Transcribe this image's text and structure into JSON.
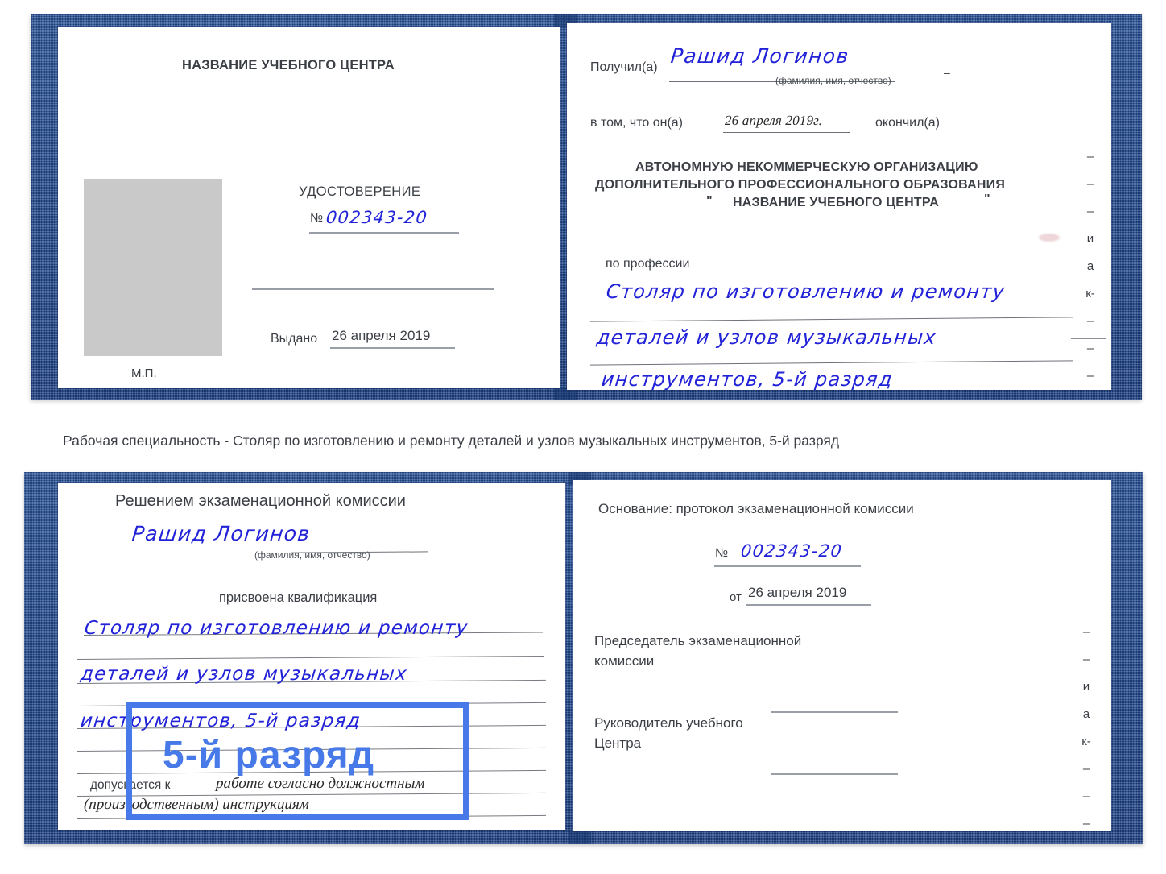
{
  "document_top": {
    "left_page": {
      "center_name_title": "НАЗВАНИЕ УЧЕБНОГО ЦЕНТРА",
      "doc_type": "УДОСТОВЕРЕНИЕ",
      "number_label": "№",
      "number_value": "002343-20",
      "issued_label": "Выдано",
      "issued_value": "26 апреля 2019",
      "stamp_label": "М.П."
    },
    "right_page": {
      "received_label": "Получил(а)",
      "received_value": "Рашид Логинов",
      "received_hint": "(фамилия, имя, отчество)",
      "in_that_label": "в том, что он(а)",
      "completion_date": "26 апреля 2019г.",
      "finished_label": "окончил(а)",
      "org_line1": "АВТОНОМНУЮ НЕКОММЕРЧЕСКУЮ ОРГАНИЗАЦИЮ",
      "org_line2": "ДОПОЛНИТЕЛЬНОГО ПРОФЕССИОНАЛЬНОГО ОБРАЗОВАНИЯ",
      "org_quote_open": "\"",
      "org_name": "НАЗВАНИЕ УЧЕБНОГО ЦЕНТРА",
      "org_quote_close": "\"",
      "profession_label": "по профессии",
      "profession_line1": "Столяр по изготовлению и ремонту",
      "profession_line2": "деталей и узлов музыкальных",
      "profession_line3": "инструментов, 5-й разряд",
      "edge_glyphs": [
        "–",
        "–",
        "–",
        "и",
        "а",
        "к-",
        "–",
        "–",
        "–"
      ]
    }
  },
  "caption": {
    "text": "Рабочая специальность - Столяр по изготовлению и ремонту деталей и узлов музыкальных инструментов, 5-й разряд"
  },
  "document_bottom": {
    "left_page": {
      "heading": "Решением экзаменационной комиссии",
      "name_value": "Рашид Логинов",
      "name_hint": "(фамилия, имя, отчество)",
      "qualification_label": "присвоена квалификация",
      "qualification_line1": "Столяр по изготовлению и ремонту",
      "qualification_line2": "деталей и узлов музыкальных",
      "qualification_line3": "инструментов, 5-й разряд",
      "admitted_label": "допускается к",
      "admitted_value_line1": "работе согласно должностным",
      "admitted_value_line2": "(производственным) инструкциям"
    },
    "right_page": {
      "basis_label": "Основание: протокол экзаменационной комиссии",
      "protocol_number_label": "№",
      "protocol_number_value": "002343-20",
      "protocol_date_label": "от",
      "protocol_date_value": "26 апреля 2019",
      "chairman_line1": "Председатель экзаменационной",
      "chairman_line2": "комиссии",
      "head_line1": "Руководитель учебного",
      "head_line2": "Центра",
      "edge_glyphs": [
        "–",
        "–",
        "и",
        "а",
        "к-",
        "–",
        "–",
        "–"
      ]
    }
  },
  "annotation": {
    "highlight_text": "5-й разряд",
    "box_color": "#4779e8",
    "text_color": "#4779e8"
  },
  "colors": {
    "cover_blue": "#214a91",
    "pen_blue": "#2222d8",
    "annotation_blue": "#4779e8",
    "paper_white": "#ffffff",
    "photo_grey": "#c9c9c9",
    "rule_grey": "#9a9ea6"
  }
}
